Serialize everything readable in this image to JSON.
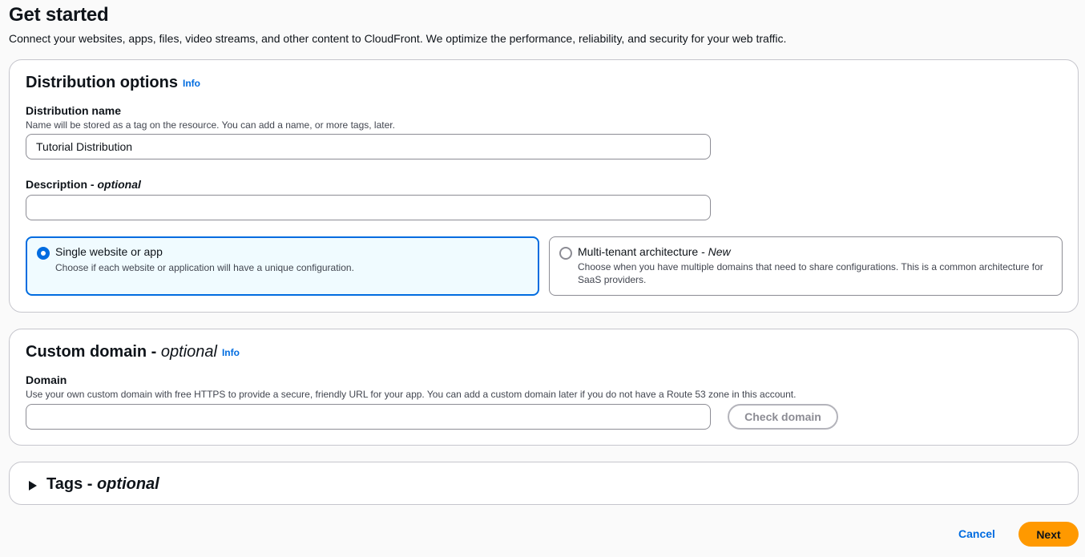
{
  "header": {
    "title": "Get started",
    "subtitle": "Connect your websites, apps, files, video streams, and other content to CloudFront. We optimize the performance, reliability, and security for your web traffic."
  },
  "distribution_options": {
    "title": "Distribution options",
    "info_label": "Info",
    "name_label": "Distribution name",
    "name_description": "Name will be stored as a tag on the resource. You can add a name, or more tags, later.",
    "name_value": "Tutorial Distribution",
    "description_label": "Description - ",
    "description_optional": "optional",
    "description_value": "",
    "options": [
      {
        "title": "Single website or app",
        "title_suffix": "",
        "description": "Choose if each website or application will have a unique configuration.",
        "selected": true
      },
      {
        "title": "Multi-tenant architecture - ",
        "title_suffix": "New",
        "description": "Choose when you have multiple domains that need to share configurations. This is a common architecture for SaaS providers.",
        "selected": false
      }
    ]
  },
  "custom_domain": {
    "title": "Custom domain - ",
    "title_optional": "optional",
    "info_label": "Info",
    "domain_label": "Domain",
    "domain_description": "Use your own custom domain with free HTTPS to provide a secure, friendly URL for your app. You can add a custom domain later if you do not have a Route 53 zone in this account.",
    "domain_value": "",
    "check_button": "Check domain"
  },
  "tags": {
    "title": "Tags - ",
    "title_optional": "optional",
    "expanded": false
  },
  "footer": {
    "cancel_label": "Cancel",
    "next_label": "Next"
  },
  "colors": {
    "accent": "#006ce0",
    "primary_button": "#ff9900",
    "selected_tile_bg": "#f0fbff"
  }
}
